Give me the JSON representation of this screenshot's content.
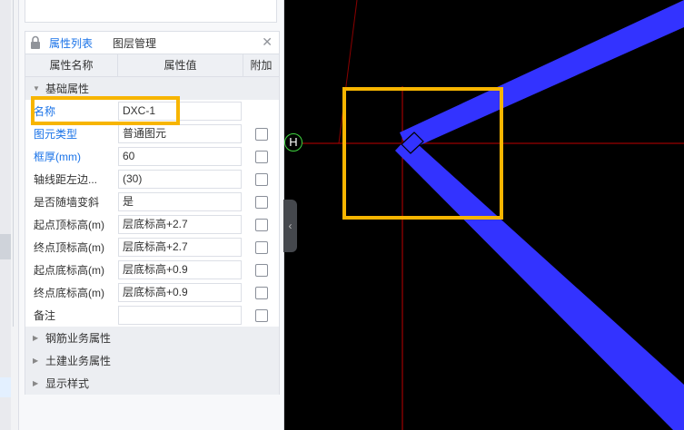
{
  "tabs": {
    "properties": "属性列表",
    "layers": "图层管理"
  },
  "headers": {
    "name": "属性名称",
    "value": "属性值",
    "extra": "附加"
  },
  "groups": {
    "basic": "基础属性",
    "rebar": "钢筋业务属性",
    "civil": "土建业务属性",
    "display": "显示样式"
  },
  "rows": [
    {
      "name": "名称",
      "value": "DXC-1",
      "highlight": true
    },
    {
      "name": "图元类型",
      "value": "普通图元",
      "highlight": true
    },
    {
      "name": "框厚(mm)",
      "value": "60",
      "highlight": true
    },
    {
      "name": "轴线距左边...",
      "value": "(30)"
    },
    {
      "name": "是否随墙变斜",
      "value": "是"
    },
    {
      "name": "起点顶标高(m)",
      "value": "层底标高+2.7"
    },
    {
      "name": "终点顶标高(m)",
      "value": "层底标高+2.7"
    },
    {
      "name": "起点底标高(m)",
      "value": "层底标高+0.9"
    },
    {
      "name": "终点底标高(m)",
      "value": "层底标高+0.9"
    },
    {
      "name": "备注",
      "value": ""
    }
  ],
  "canvas": {
    "axis_label": "H"
  },
  "colors": {
    "accent": "#1a73e8",
    "highlight_box": "#f7b500",
    "member_fill": "#3333ff",
    "axis_line": "#c00000",
    "canvas_bg": "#000000"
  },
  "icons": {
    "lock": "lock-icon",
    "close": "close-icon",
    "collapse": "chevron-left-icon"
  }
}
